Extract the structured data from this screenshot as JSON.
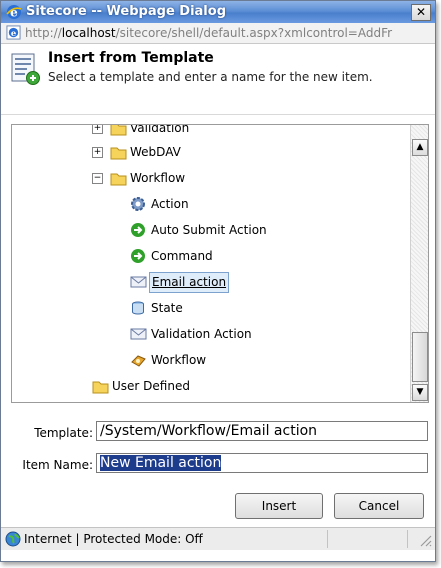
{
  "window": {
    "title": "Sitecore -- Webpage Dialog",
    "close_label": "✕",
    "url_prefix": "http://",
    "url_host": "localhost",
    "url_rest": "/sitecore/shell/default.aspx?xmlcontrol=AddFr"
  },
  "header": {
    "title": "Insert from Template",
    "subtitle": "Select a template and enter a name for the new item."
  },
  "tree": {
    "items": [
      {
        "label": "Validation",
        "icon": "folder-icon",
        "expander": "+"
      },
      {
        "label": "WebDAV",
        "icon": "folder-icon",
        "expander": "+"
      },
      {
        "label": "Workflow",
        "icon": "folder-icon",
        "expander": "−"
      },
      {
        "label": "Action",
        "icon": "gear-icon"
      },
      {
        "label": "Auto Submit Action",
        "icon": "green-arrow-icon"
      },
      {
        "label": "Command",
        "icon": "green-arrow-icon"
      },
      {
        "label": "Email action",
        "icon": "envelope-icon",
        "selected": true
      },
      {
        "label": "State",
        "icon": "state-icon"
      },
      {
        "label": "Validation Action",
        "icon": "envelope-icon"
      },
      {
        "label": "Workflow",
        "icon": "workflow-icon"
      },
      {
        "label": "User Defined",
        "icon": "folder-icon"
      }
    ],
    "scroll_up": "▲",
    "scroll_down": "▼"
  },
  "form": {
    "template_label": "Template:",
    "template_value": "/System/Workflow/Email action",
    "item_name_label": "Item Name:",
    "item_name_value": "New Email action"
  },
  "buttons": {
    "insert": "Insert",
    "cancel": "Cancel"
  },
  "status": {
    "text": "Internet | Protected Mode: Off"
  },
  "colors": {
    "selection": "#1e3c8c",
    "tree_selected_bg": "#dfecf9"
  }
}
